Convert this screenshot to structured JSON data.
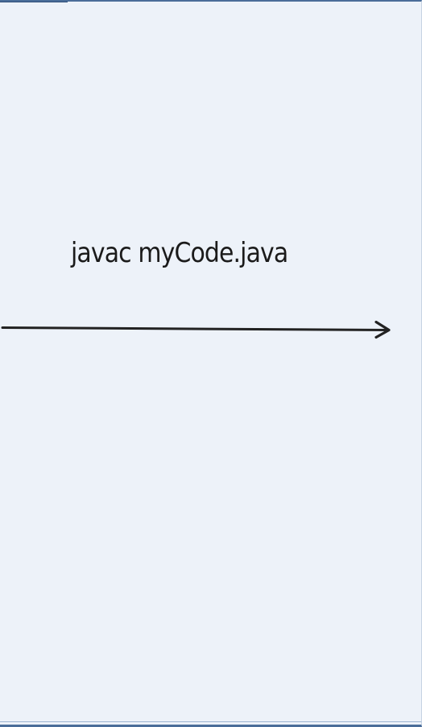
{
  "diagram": {
    "command": "javac myCode.java",
    "arrow": {
      "direction": "right",
      "color": "#222222"
    }
  },
  "colors": {
    "background": "#edf2f9",
    "border": "#4a6d99",
    "text": "#1b1b1b"
  }
}
